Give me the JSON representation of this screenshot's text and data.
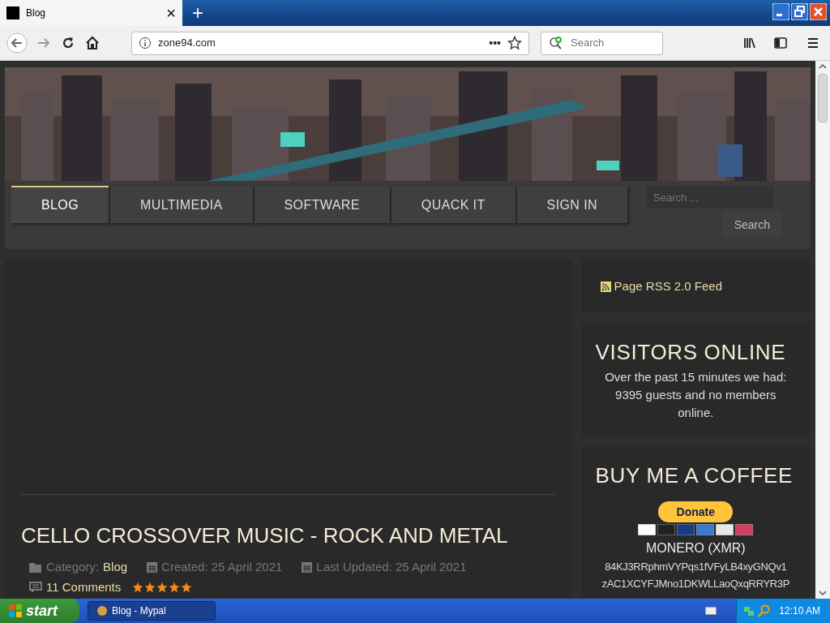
{
  "browser": {
    "tab_title": "Blog",
    "new_tab": "+",
    "close_tab": "×",
    "url": "zone94.com",
    "search_placeholder": "Search",
    "page_actions": "•••"
  },
  "menu": [
    {
      "label": "BLOG",
      "selected": true
    },
    {
      "label": "MULTIMEDIA",
      "selected": false
    },
    {
      "label": "SOFTWARE",
      "selected": false
    },
    {
      "label": "QUACK IT",
      "selected": false
    },
    {
      "label": "SIGN IN",
      "selected": false
    }
  ],
  "site_search": {
    "placeholder": "Search ...",
    "button": "Search"
  },
  "article": {
    "title": "CELLO CROSSOVER MUSIC - ROCK AND METAL",
    "category_label": "Category:",
    "category": "Blog",
    "created": "Created: 25 April 2021",
    "updated": "Last Updated: 25 April 2021",
    "comments": "11 Comments",
    "stars": 5
  },
  "sidebar": {
    "rss": "Page RSS 2.0 Feed",
    "visitors_title": "VISITORS ONLINE",
    "visitors_text": "Over the past 15 minutes we had: 9395 guests and no members online.",
    "coffee_title": "BUY ME A COFFEE",
    "donate": "Donate",
    "monero": "MONERO (XMR)",
    "address_lines": [
      "84KJ3RRphmVYPqs1fVFyLB4xyGNQv1",
      "zAC1XCYFJMno1DKWLLaoQxqRRYR3P"
    ]
  },
  "taskbar": {
    "start": "start",
    "task": "Blog - Mypal",
    "clock": "12:10 AM"
  }
}
